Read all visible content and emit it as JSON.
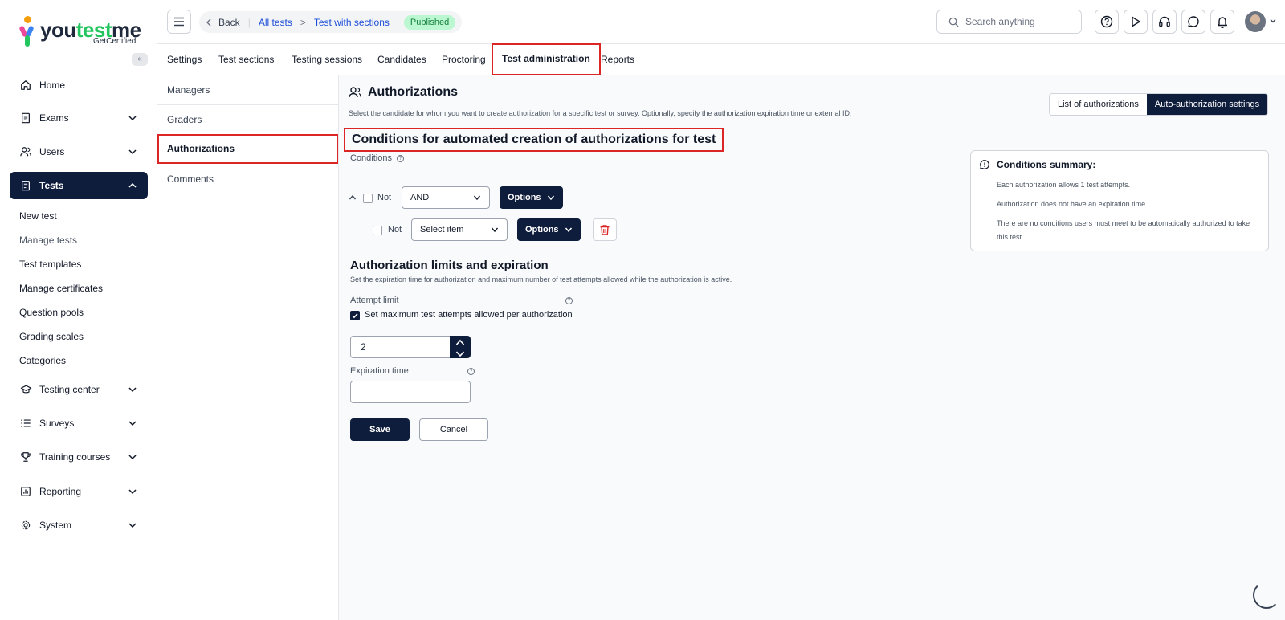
{
  "brand": {
    "name_a": "you",
    "name_b": "test",
    "name_c": "me",
    "tagline": "GetCertified"
  },
  "sidebar": {
    "collapse_glyph": "«",
    "items": [
      {
        "label": "Home",
        "icon": "home-icon"
      },
      {
        "label": "Exams",
        "icon": "document-icon"
      },
      {
        "label": "Users",
        "icon": "users-icon"
      },
      {
        "label": "Tests",
        "icon": "clipboard-icon",
        "active": true
      },
      {
        "label": "Testing center",
        "icon": "graduation-cap-icon"
      },
      {
        "label": "Surveys",
        "icon": "list-icon"
      },
      {
        "label": "Training courses",
        "icon": "trophy-icon"
      },
      {
        "label": "Reporting",
        "icon": "chart-icon"
      },
      {
        "label": "System",
        "icon": "gear-icon"
      }
    ],
    "tests_sub": [
      "New test",
      "Manage tests",
      "Test templates",
      "Manage certificates",
      "Question pools",
      "Grading scales",
      "Categories"
    ]
  },
  "topbar": {
    "back": "Back",
    "crumb1": "All tests",
    "crumb_sep": ">",
    "crumb2": "Test with sections",
    "status": "Published",
    "search_placeholder": "Search anything"
  },
  "tabs": [
    "Settings",
    "Test sections",
    "Testing sessions",
    "Candidates",
    "Proctoring",
    "Test administration",
    "Reports"
  ],
  "submenu": [
    "Managers",
    "Graders",
    "Authorizations",
    "Comments"
  ],
  "main": {
    "title": "Authorizations",
    "description": "Select the candidate for whom you want to create authorization for a specific test or survey. Optionally, specify the authorization expiration time or external ID.",
    "view_toggle": [
      "List of authorizations",
      "Auto-authorization settings"
    ],
    "conditions_heading": "Conditions for automated creation of authorizations for test",
    "conditions_label": "Conditions",
    "row1": {
      "not_label": "Not",
      "operator": "AND",
      "options_label": "Options"
    },
    "row2": {
      "not_label": "Not",
      "select_placeholder": "Select item",
      "options_label": "Options"
    },
    "summary": {
      "title": "Conditions summary:",
      "lines": [
        "Each authorization allows 1 test attempts.",
        "Authorization does not have an expiration time.",
        "There are no conditions users must meet to be automatically authorized to take this test."
      ]
    },
    "limits": {
      "title": "Authorization limits and expiration",
      "description": "Set the expiration time for authorization and maximum number of test attempts allowed while the authorization is active.",
      "attempt_label": "Attempt limit",
      "checkbox_label": "Set maximum test attempts allowed per authorization",
      "attempt_value": "2",
      "expiration_label": "Expiration time",
      "expiration_value": ""
    },
    "save": "Save",
    "cancel": "Cancel"
  },
  "colors": {
    "primary": "#0f1d3d",
    "highlight": "#dc2626",
    "link": "#1d4ed8",
    "published_bg": "#bbf7d0",
    "published_text": "#15803d"
  }
}
